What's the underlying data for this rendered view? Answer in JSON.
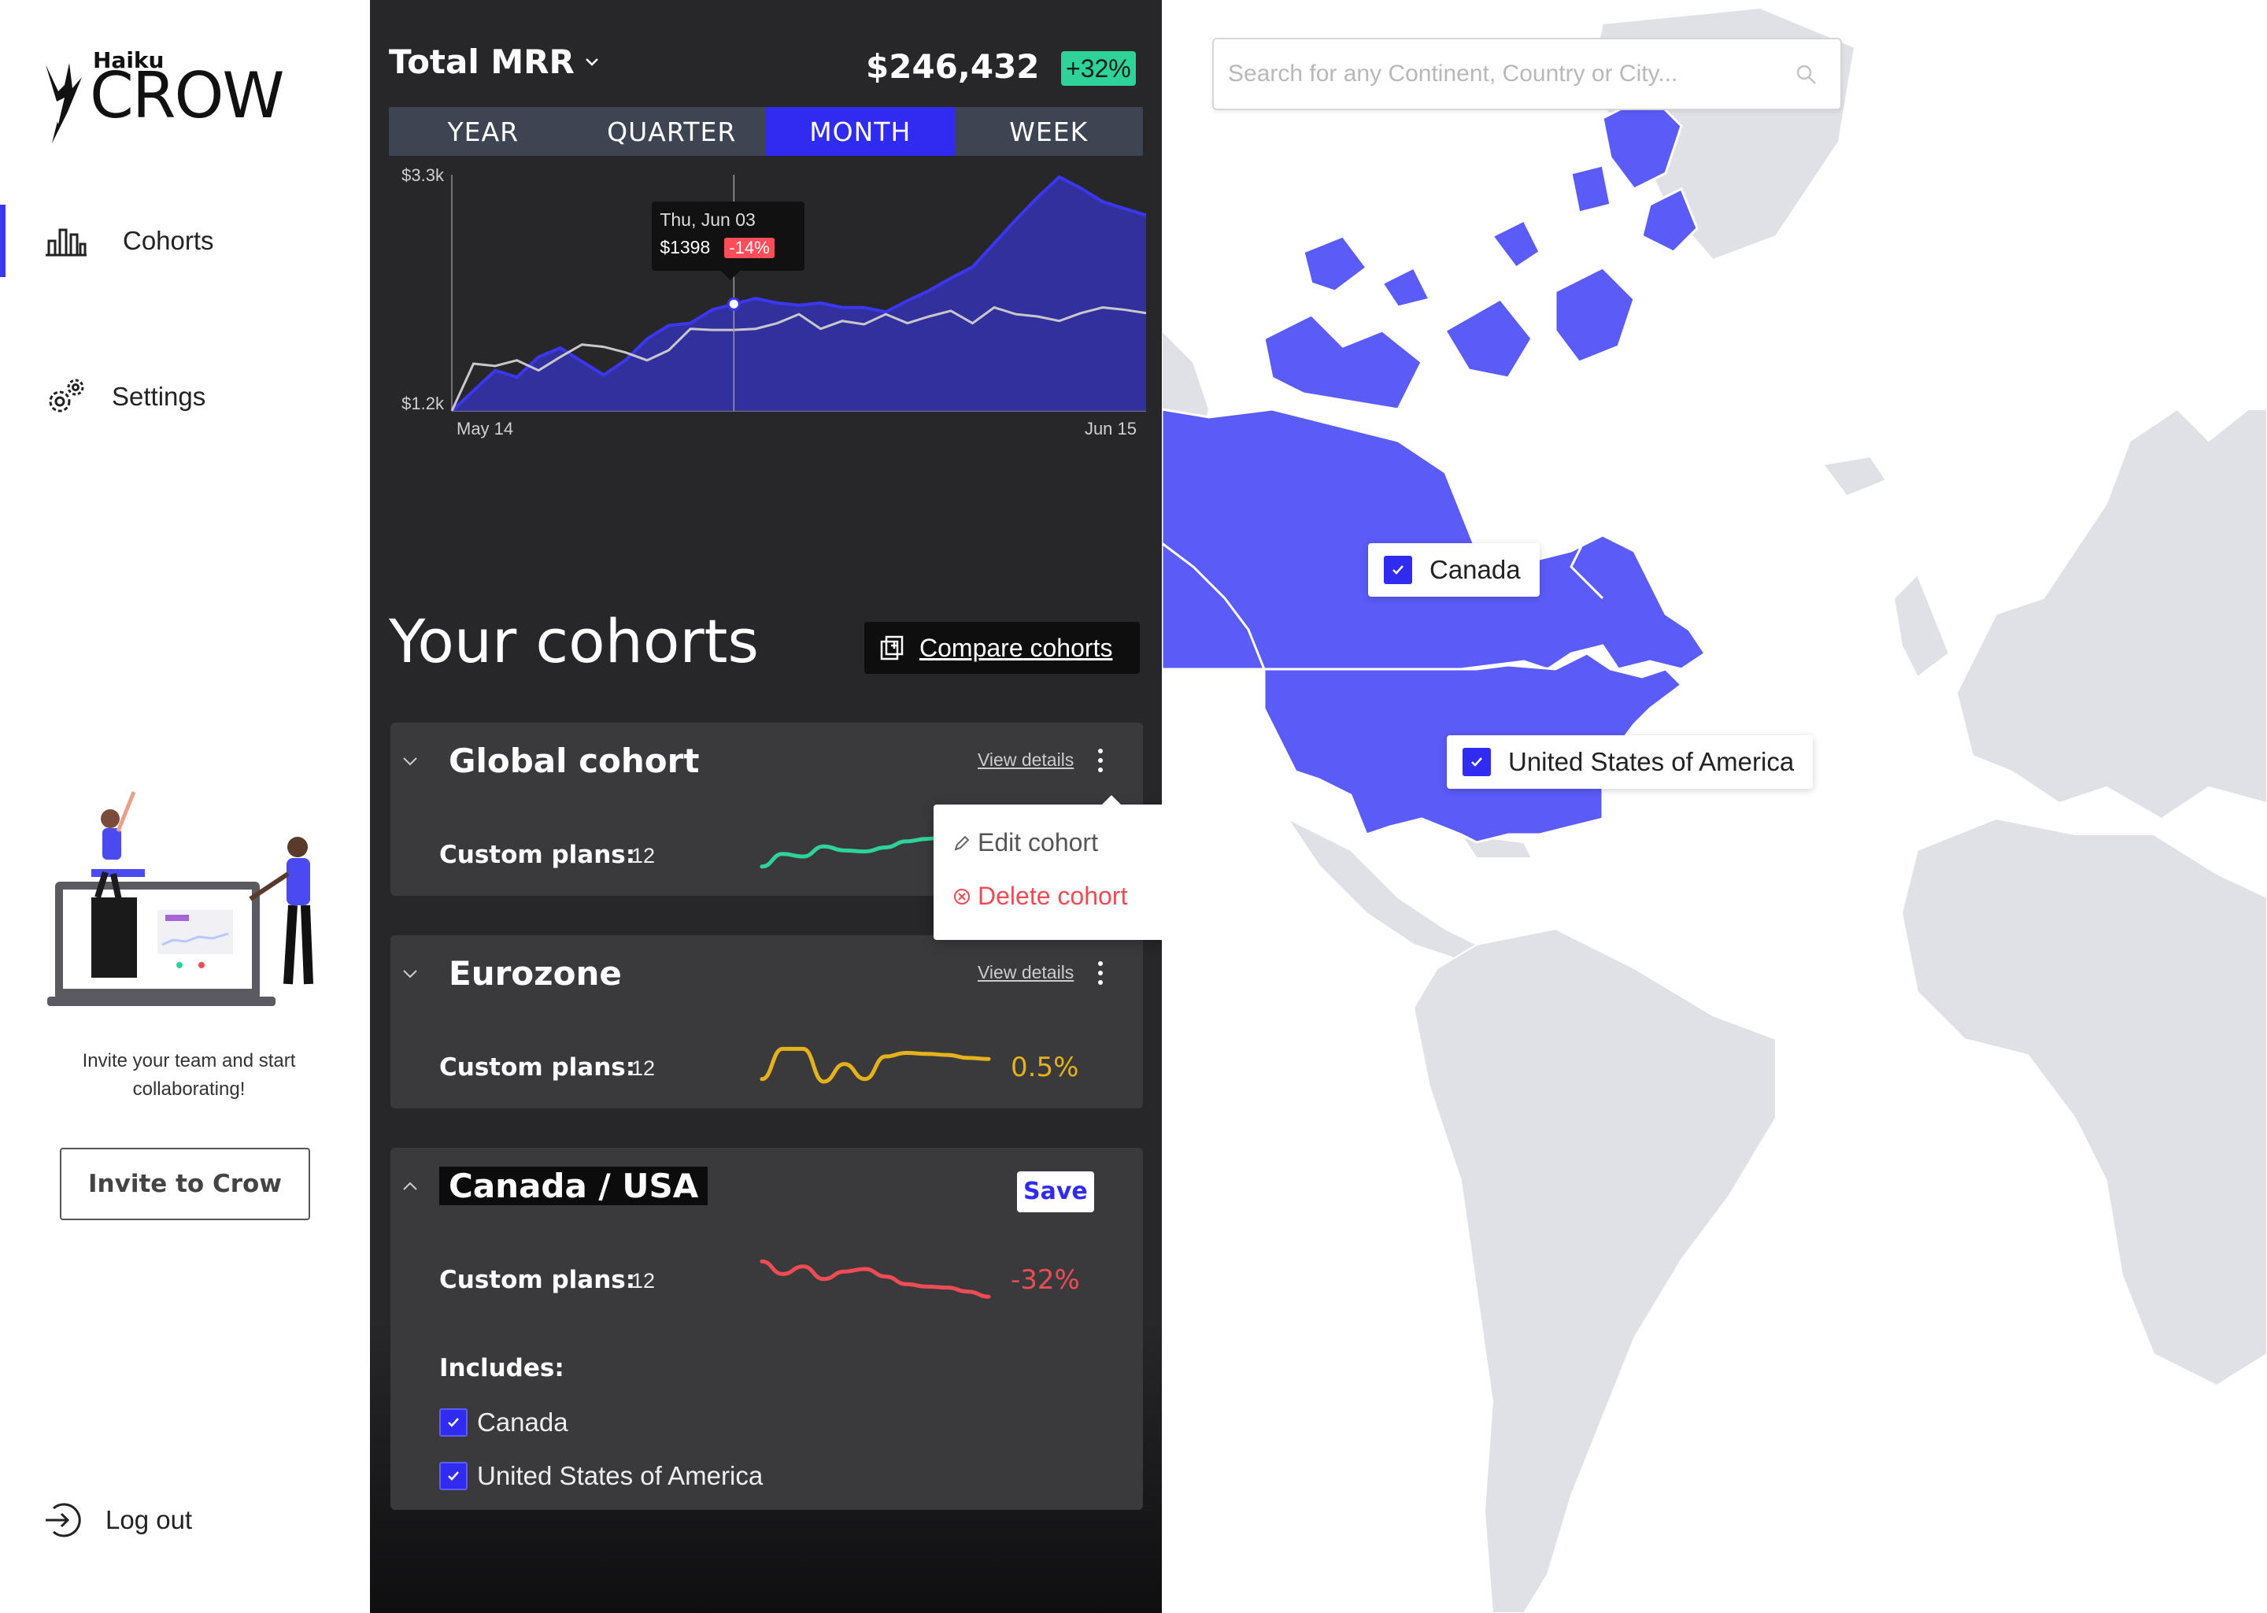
{
  "sidebar": {
    "brand_small": "Haiku",
    "brand_big": "CROW",
    "nav": [
      {
        "label": "Cohorts",
        "icon": "bar-chart-icon",
        "active": true
      },
      {
        "label": "Settings",
        "icon": "gears-icon",
        "active": false
      }
    ],
    "invite_text": "Invite your team and start collaborating!",
    "invite_button": "Invite to Crow",
    "logout": "Log out"
  },
  "mrr": {
    "title": "Total MRR",
    "value": "$246,432",
    "change": "+32%",
    "tabs": [
      "YEAR",
      "QUARTER",
      "MONTH",
      "WEEK"
    ],
    "active_tab": "MONTH"
  },
  "chart_data": {
    "type": "area",
    "title": "Total MRR",
    "y_ticks": [
      "$3.3k",
      "$1.2k"
    ],
    "x_ticks": [
      "May 14",
      "Jun 15"
    ],
    "ylim": [
      1200,
      3300
    ],
    "x": [
      0,
      1,
      2,
      3,
      4,
      5,
      6,
      7,
      8,
      9,
      10,
      11,
      12,
      13,
      14,
      15,
      16,
      17,
      18,
      19,
      20,
      21,
      22,
      23,
      24,
      25,
      26,
      27,
      28,
      29,
      30,
      31,
      32
    ],
    "series": [
      {
        "name": "",
        "color": "#3b37f0",
        "values": [
          1200,
          1380,
          1560,
          1500,
          1680,
          1760,
          1640,
          1520,
          1650,
          1840,
          1960,
          1980,
          2100,
          2150,
          2200,
          2160,
          2140,
          2160,
          2120,
          2120,
          2080,
          2180,
          2270,
          2380,
          2480,
          2690,
          2900,
          3100,
          3280,
          3180,
          3060,
          3000,
          2940
        ]
      },
      {
        "name": "",
        "color": "#c8c8cc",
        "values": [
          1200,
          1620,
          1600,
          1650,
          1560,
          1680,
          1790,
          1770,
          1720,
          1650,
          1740,
          1930,
          1920,
          1920,
          1930,
          1980,
          2060,
          1930,
          2000,
          1970,
          2060,
          1980,
          2040,
          2090,
          1980,
          2120,
          2060,
          2040,
          2000,
          2070,
          2120,
          2100,
          2070
        ]
      }
    ],
    "tooltip": {
      "date": "Thu, Jun 03",
      "value": "$1398",
      "change": "-14%",
      "index": 13
    }
  },
  "cohorts": {
    "title": "Your cohorts",
    "compare": "Compare cohorts",
    "items": [
      {
        "name": "Global cohort",
        "details": "View details",
        "plans_label": "Custom plans:",
        "plans_value": "12",
        "change": "",
        "color": "#2fd39a",
        "spark": [
          0.3,
          0.55,
          0.5,
          0.7,
          0.62,
          0.6,
          0.68,
          0.8,
          0.85,
          0.9,
          0.88,
          0.9
        ]
      },
      {
        "name": "Eurozone",
        "details": "View details",
        "plans_label": "Custom plans:",
        "plans_value": "12",
        "change": "0.5%",
        "color": "#e5b21b",
        "spark": [
          0.3,
          0.9,
          0.9,
          0.25,
          0.6,
          0.3,
          0.75,
          0.82,
          0.8,
          0.78,
          0.72,
          0.7
        ]
      },
      {
        "name": "Canada / USA",
        "details": "",
        "plans_label": "Custom plans:",
        "plans_value": "12",
        "change": "-32%",
        "color": "#ef4b55",
        "save": "Save",
        "includes": "Includes:",
        "spark": [
          0.9,
          0.65,
          0.8,
          0.55,
          0.7,
          0.75,
          0.6,
          0.45,
          0.4,
          0.38,
          0.3,
          0.2
        ]
      }
    ],
    "include_items": [
      "Canada",
      "United States of America"
    ]
  },
  "menu": {
    "edit": "Edit cohort",
    "delete": "Delete cohort"
  },
  "map": {
    "search_placeholder": "Search for any Continent, Country or City...",
    "labels": [
      "Canada",
      "United States of America"
    ],
    "highlight_color": "#5b5bf7",
    "land_color": "#dfe1e6"
  }
}
